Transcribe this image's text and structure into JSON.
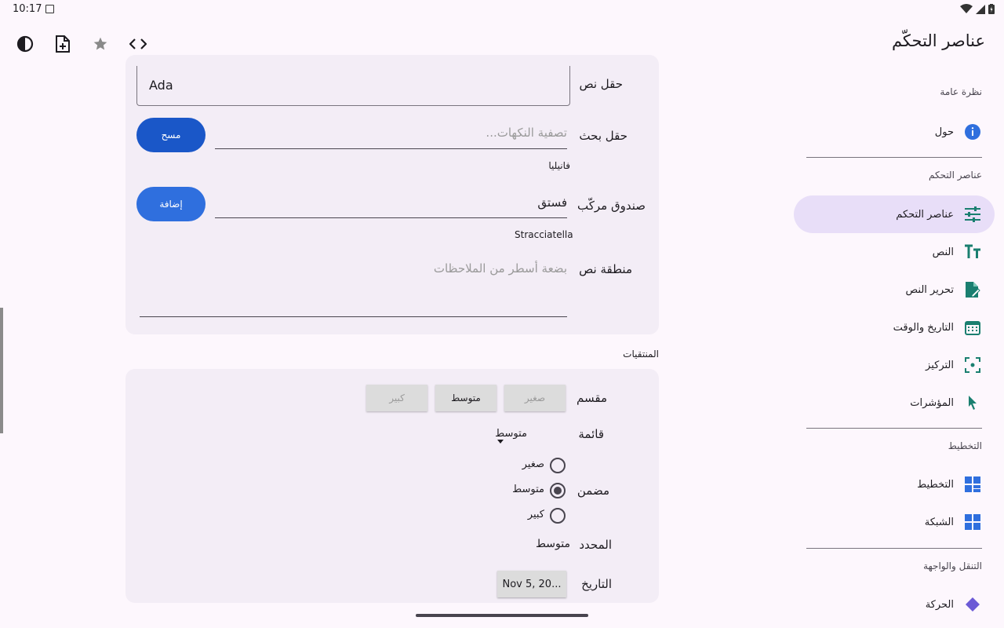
{
  "status": {
    "time": "10:17"
  },
  "app": {
    "title": "عناصر التحكّم"
  },
  "nav": {
    "sections": [
      "نظرة عامة",
      "عناصر التحكم",
      "التخطيط",
      "التنقل والواجهة"
    ],
    "items": [
      {
        "label": "حول",
        "icon": "info-icon"
      },
      {
        "label": "عناصر التحكم",
        "icon": "tune-icon"
      },
      {
        "label": "النص",
        "icon": "text-icon"
      },
      {
        "label": "تحرير النص",
        "icon": "edit-doc-icon"
      },
      {
        "label": "التاريخ والوقت",
        "icon": "calendar-icon"
      },
      {
        "label": "التركيز",
        "icon": "focus-icon"
      },
      {
        "label": "المؤشرات",
        "icon": "pointer-icon"
      },
      {
        "label": "التخطيط",
        "icon": "layout-icon"
      },
      {
        "label": "الشبكة",
        "icon": "grid-icon"
      },
      {
        "label": "الحركة",
        "icon": "diamond-icon"
      }
    ]
  },
  "form": {
    "text_field": {
      "label": "حقل نص",
      "value": "Ada"
    },
    "search_field": {
      "label": "حقل بحث",
      "placeholder": "تصفية النكهات...",
      "button": "مسح",
      "hint": "فانيليا"
    },
    "combo_box": {
      "label": "صندوق مركّب",
      "value": "فستق",
      "button": "إضافة",
      "hint": "Stracciatella"
    },
    "text_area": {
      "label": "منطقة نص",
      "placeholder": "بضعة أسطر من الملاحظات"
    }
  },
  "pickers": {
    "section_title": "المنتقيات",
    "segmented": {
      "label": "مقسم",
      "options": [
        "صغير",
        "متوسط",
        "كبير"
      ],
      "selected": "متوسط"
    },
    "dropdown": {
      "label": "قائمة",
      "value": "متوسط"
    },
    "radio": {
      "label": "مضمن",
      "options": [
        "صغير",
        "متوسط",
        "كبير"
      ],
      "selected": "متوسط"
    },
    "selected": {
      "label": "المحدد",
      "value": "متوسط"
    },
    "date": {
      "label": "التاريخ",
      "value": "Nov 5, 20..."
    }
  }
}
